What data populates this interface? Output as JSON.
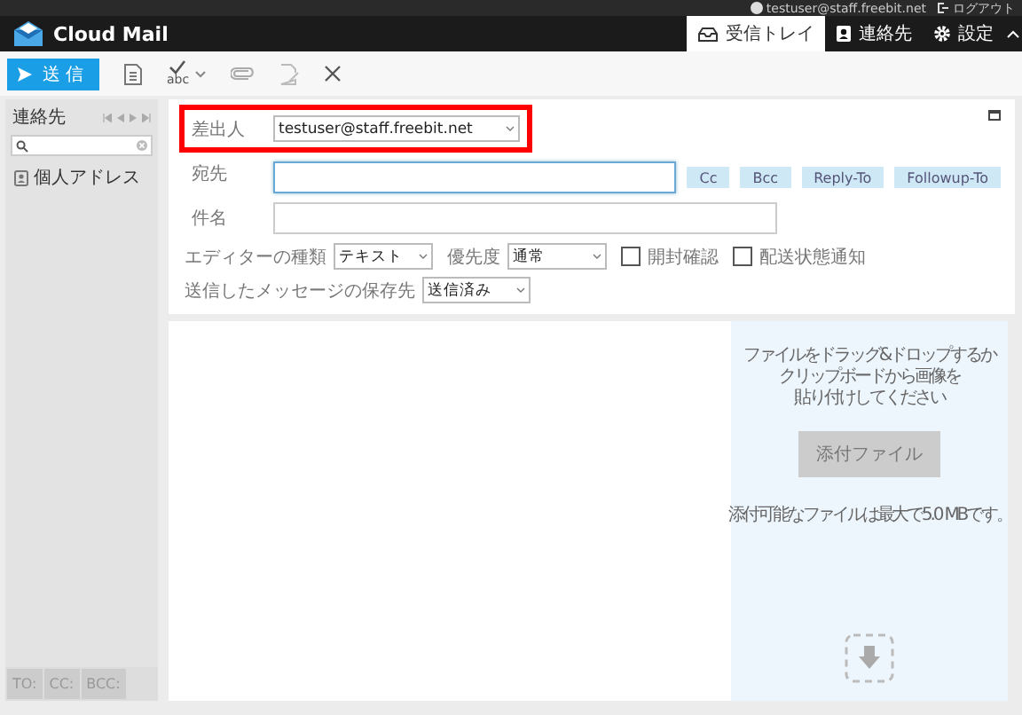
{
  "header": {
    "user": "testuser@staff.freebit.net",
    "logout": "ログアウト",
    "app_name": "Cloud Mail",
    "tabs": [
      {
        "label": "受信トレイ",
        "selected": true
      },
      {
        "label": "連絡先",
        "selected": false
      },
      {
        "label": "設定",
        "selected": false
      }
    ]
  },
  "toolbar": {
    "send": "送 信",
    "spellcheck_label": "abc"
  },
  "sidebar": {
    "title": "連絡先",
    "items": [
      {
        "label": "個人アドレス"
      }
    ],
    "bottom_buttons": [
      "TO:",
      "CC:",
      "BCC:"
    ]
  },
  "form": {
    "from": {
      "label": "差出人",
      "value": "testuser@staff.freebit.net",
      "highlighted": true
    },
    "to_label": "宛先",
    "subject_label": "件名",
    "address_buttons": [
      "Cc",
      "Bcc",
      "Reply-To",
      "Followup-To"
    ],
    "editor_label": "エディターの種類",
    "editor_value": "テキスト",
    "priority_label": "優先度",
    "priority_value": "通常",
    "checkboxes": [
      {
        "label": "開封確認",
        "checked": false
      },
      {
        "label": "配送状態通知",
        "checked": false
      }
    ],
    "save_label": "送信したメッセージの保存先",
    "save_value": "送信済み"
  },
  "attach": {
    "hint_lines": [
      "ファイルをドラッグ&ドロップするか",
      "クリップボードから画像を",
      "貼り付けしてください"
    ],
    "button": "添付ファイル",
    "limit": "添付可能なファイルは最大で5.0 MBです。"
  }
}
